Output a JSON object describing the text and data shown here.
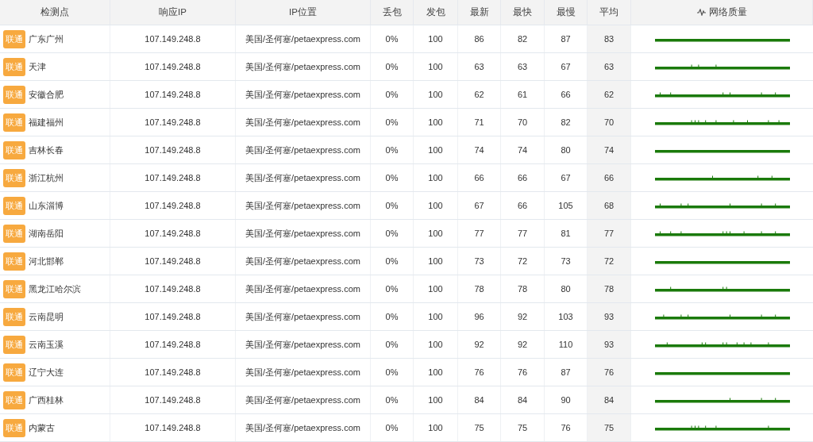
{
  "table": {
    "columns": [
      {
        "label": "检测点"
      },
      {
        "label": "响应IP"
      },
      {
        "label": "IP位置"
      },
      {
        "label": "丢包"
      },
      {
        "label": "发包"
      },
      {
        "label": "最新"
      },
      {
        "label": "最快"
      },
      {
        "label": "最慢"
      },
      {
        "label": "平均"
      },
      {
        "label": "网络质量"
      }
    ],
    "rows": [
      {
        "isp": "联通",
        "node": "广东广州",
        "ip": "107.149.248.8",
        "location": "美国/圣何塞/petaexpress.com",
        "loss": "0%",
        "sent": "100",
        "latest": "86",
        "fastest": "82",
        "slowest": "87",
        "average": "83"
      },
      {
        "isp": "联通",
        "node": "天津",
        "ip": "107.149.248.8",
        "location": "美国/圣何塞/petaexpress.com",
        "loss": "0%",
        "sent": "100",
        "latest": "63",
        "fastest": "63",
        "slowest": "67",
        "average": "63"
      },
      {
        "isp": "联通",
        "node": "安徽合肥",
        "ip": "107.149.248.8",
        "location": "美国/圣何塞/petaexpress.com",
        "loss": "0%",
        "sent": "100",
        "latest": "62",
        "fastest": "61",
        "slowest": "66",
        "average": "62"
      },
      {
        "isp": "联通",
        "node": "福建福州",
        "ip": "107.149.248.8",
        "location": "美国/圣何塞/petaexpress.com",
        "loss": "0%",
        "sent": "100",
        "latest": "71",
        "fastest": "70",
        "slowest": "82",
        "average": "70"
      },
      {
        "isp": "联通",
        "node": "吉林长春",
        "ip": "107.149.248.8",
        "location": "美国/圣何塞/petaexpress.com",
        "loss": "0%",
        "sent": "100",
        "latest": "74",
        "fastest": "74",
        "slowest": "80",
        "average": "74"
      },
      {
        "isp": "联通",
        "node": "浙江杭州",
        "ip": "107.149.248.8",
        "location": "美国/圣何塞/petaexpress.com",
        "loss": "0%",
        "sent": "100",
        "latest": "66",
        "fastest": "66",
        "slowest": "67",
        "average": "66"
      },
      {
        "isp": "联通",
        "node": "山东淄博",
        "ip": "107.149.248.8",
        "location": "美国/圣何塞/petaexpress.com",
        "loss": "0%",
        "sent": "100",
        "latest": "67",
        "fastest": "66",
        "slowest": "105",
        "average": "68"
      },
      {
        "isp": "联通",
        "node": "湖南岳阳",
        "ip": "107.149.248.8",
        "location": "美国/圣何塞/petaexpress.com",
        "loss": "0%",
        "sent": "100",
        "latest": "77",
        "fastest": "77",
        "slowest": "81",
        "average": "77"
      },
      {
        "isp": "联通",
        "node": "河北邯郸",
        "ip": "107.149.248.8",
        "location": "美国/圣何塞/petaexpress.com",
        "loss": "0%",
        "sent": "100",
        "latest": "73",
        "fastest": "72",
        "slowest": "73",
        "average": "72"
      },
      {
        "isp": "联通",
        "node": "黑龙江哈尔滨",
        "ip": "107.149.248.8",
        "location": "美国/圣何塞/petaexpress.com",
        "loss": "0%",
        "sent": "100",
        "latest": "78",
        "fastest": "78",
        "slowest": "80",
        "average": "78"
      },
      {
        "isp": "联通",
        "node": "云南昆明",
        "ip": "107.149.248.8",
        "location": "美国/圣何塞/petaexpress.com",
        "loss": "0%",
        "sent": "100",
        "latest": "96",
        "fastest": "92",
        "slowest": "103",
        "average": "93"
      },
      {
        "isp": "联通",
        "node": "云南玉溪",
        "ip": "107.149.248.8",
        "location": "美国/圣何塞/petaexpress.com",
        "loss": "0%",
        "sent": "100",
        "latest": "92",
        "fastest": "92",
        "slowest": "110",
        "average": "93"
      },
      {
        "isp": "联通",
        "node": "辽宁大连",
        "ip": "107.149.248.8",
        "location": "美国/圣何塞/petaexpress.com",
        "loss": "0%",
        "sent": "100",
        "latest": "76",
        "fastest": "76",
        "slowest": "87",
        "average": "76"
      },
      {
        "isp": "联通",
        "node": "广西桂林",
        "ip": "107.149.248.8",
        "location": "美国/圣何塞/petaexpress.com",
        "loss": "0%",
        "sent": "100",
        "latest": "84",
        "fastest": "84",
        "slowest": "90",
        "average": "84"
      },
      {
        "isp": "联通",
        "node": "内蒙古",
        "ip": "107.149.248.8",
        "location": "美国/圣何塞/petaexpress.com",
        "loss": "0%",
        "sent": "100",
        "latest": "75",
        "fastest": "75",
        "slowest": "76",
        "average": "75"
      }
    ]
  }
}
